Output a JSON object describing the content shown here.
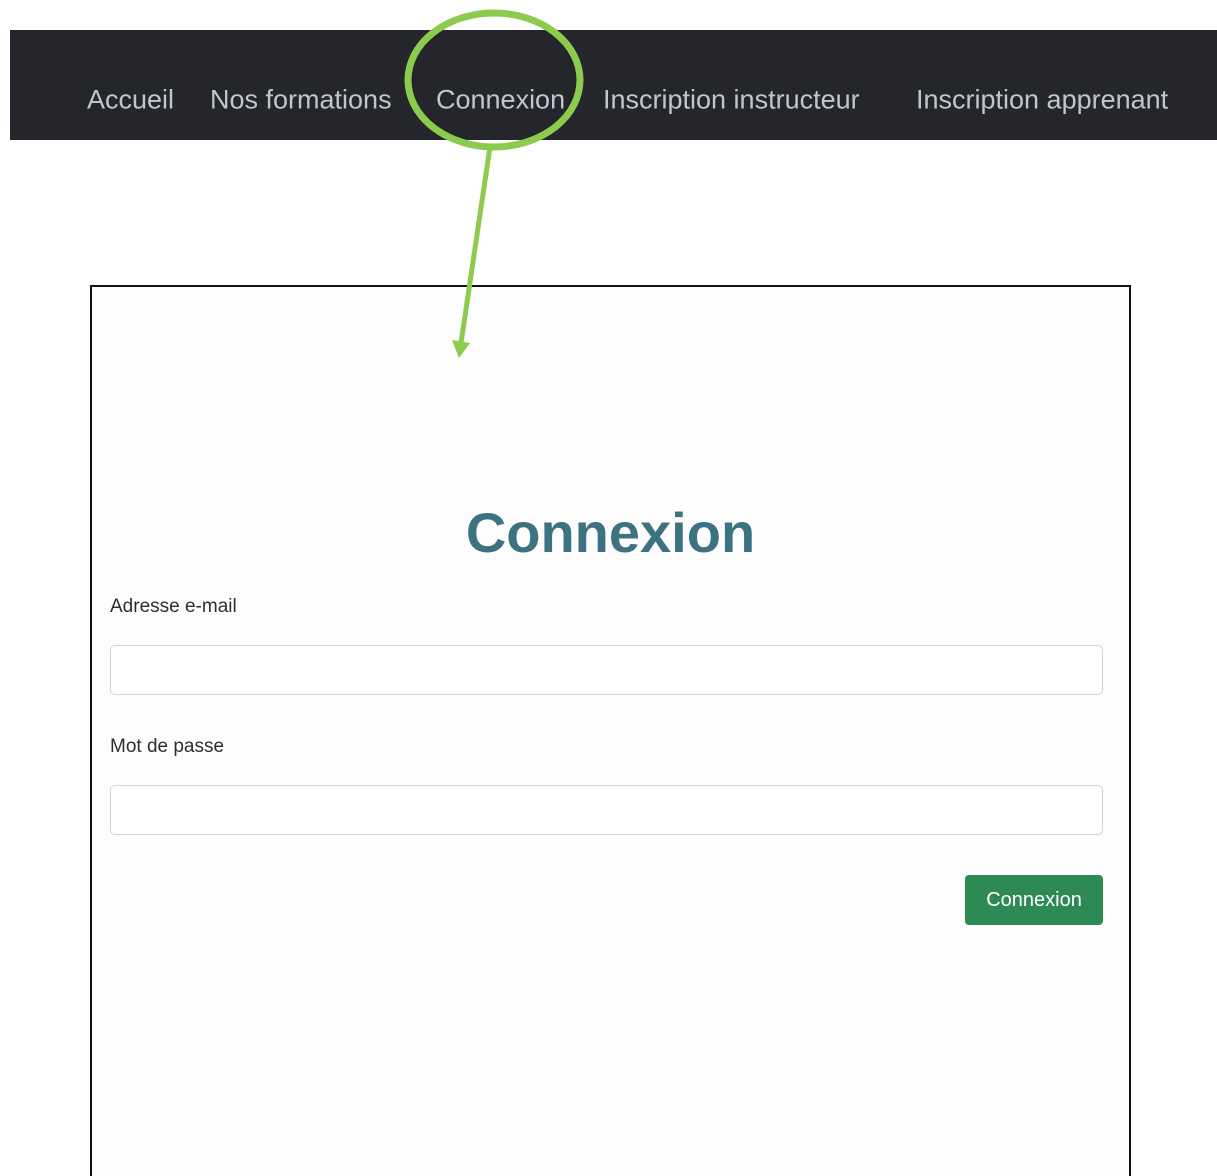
{
  "nav": {
    "items": [
      {
        "label": "Accueil"
      },
      {
        "label": "Nos formations"
      },
      {
        "label": "Connexion"
      },
      {
        "label": "Inscription instructeur"
      },
      {
        "label": "Inscription apprenant"
      }
    ]
  },
  "annotation": {
    "highlight_color": "#8ccb4d",
    "target": "Connexion"
  },
  "login": {
    "title": "Connexion",
    "email_label": "Adresse e-mail",
    "email_value": "",
    "password_label": "Mot de passe",
    "password_value": "",
    "submit_label": "Connexion"
  },
  "colors": {
    "navbar_bg": "#24262b",
    "nav_text": "#c2c6cc",
    "title": "#3d7380",
    "button_bg": "#2e8a55"
  }
}
